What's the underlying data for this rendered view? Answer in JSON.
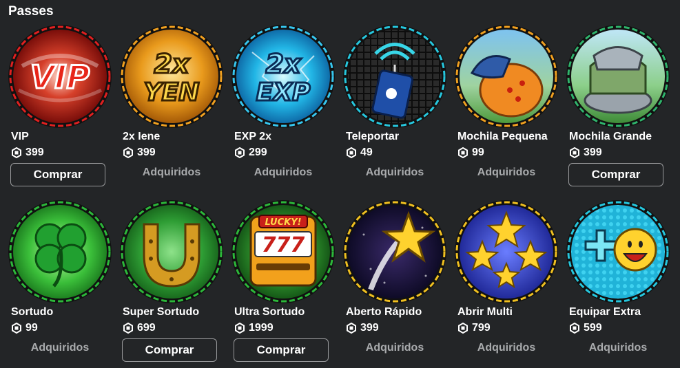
{
  "section": {
    "title": "Passes"
  },
  "labels": {
    "buy": "Comprar",
    "owned": "Adquiridos"
  },
  "passes": [
    {
      "name": "VIP",
      "price": "399",
      "status": "buy",
      "icon": "vip-badge-icon",
      "art_text": "VIP"
    },
    {
      "name": "2x Iene",
      "price": "399",
      "status": "owned",
      "icon": "2x-yen-badge-icon",
      "art_text": "2x YEN"
    },
    {
      "name": "EXP 2x",
      "price": "299",
      "status": "owned",
      "icon": "2x-exp-badge-icon",
      "art_text": "2x EXP"
    },
    {
      "name": "Teleportar",
      "price": "49",
      "status": "owned",
      "icon": "teleport-device-icon"
    },
    {
      "name": "Mochila Pequena",
      "price": "99",
      "status": "owned",
      "icon": "small-backpack-icon"
    },
    {
      "name": "Mochila Grande",
      "price": "399",
      "status": "buy",
      "icon": "large-backpack-icon"
    },
    {
      "name": "Sortudo",
      "price": "99",
      "status": "owned",
      "icon": "four-leaf-clover-icon"
    },
    {
      "name": "Super Sortudo",
      "price": "699",
      "status": "buy",
      "icon": "horseshoe-icon"
    },
    {
      "name": "Ultra Sortudo",
      "price": "1999",
      "status": "buy",
      "icon": "slot-machine-icon",
      "art_text": "LUCKY!"
    },
    {
      "name": "Aberto Rápido",
      "price": "399",
      "status": "owned",
      "icon": "shooting-star-icon"
    },
    {
      "name": "Abrir Multi",
      "price": "799",
      "status": "owned",
      "icon": "multi-star-icon"
    },
    {
      "name": "Equipar Extra",
      "price": "599",
      "status": "owned",
      "icon": "plus-smiley-icon"
    }
  ]
}
